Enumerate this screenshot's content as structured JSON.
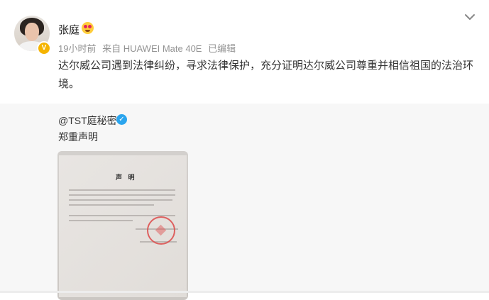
{
  "post": {
    "author": "张庭",
    "author_verified_icon": "v-badge-icon",
    "emoji": "love-emoji",
    "time": "19小时前",
    "source": "来自 HUAWEI Mate 40E",
    "edited": "已编辑",
    "text": "达尔威公司遇到法律纠纷，寻求法律保护，充分证明达尔威公司尊重并相信祖国的法治环境。",
    "menu_icon": "chevron-down-icon"
  },
  "repost": {
    "author": "@TST庭秘密",
    "verified_icon": "blue-v-badge-icon",
    "text": "郑重声明",
    "image": {
      "doc_title": "声 明"
    }
  },
  "colors": {
    "meta_gray": "#939393",
    "repost_bg": "#f7f7f7",
    "verified_yellow": "#f5b400",
    "verified_blue": "#2ba5ee"
  }
}
